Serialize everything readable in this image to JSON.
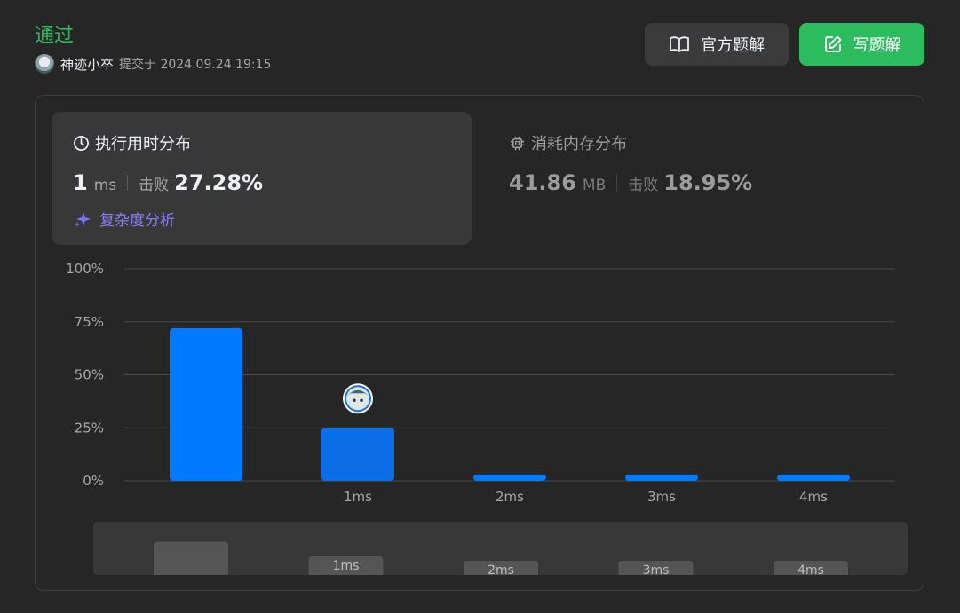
{
  "submission": {
    "status": "通过",
    "user_name": "神迹小卒",
    "submitted_label": "提交于 2024.09.24 19:15"
  },
  "buttons": {
    "editorial": "官方题解",
    "write_solution": "写题解"
  },
  "runtime": {
    "title": "执行用时分布",
    "value": "1",
    "unit": "ms",
    "beats_label": "击败",
    "beats_pct": "27.28%",
    "complexity_link": "复杂度分析"
  },
  "memory": {
    "title": "消耗内存分布",
    "value": "41.86",
    "unit": "MB",
    "beats_label": "击败",
    "beats_pct": "18.95%"
  },
  "colors": {
    "accepted": "#2cbb5d",
    "bar": "#007aff",
    "bar_selected": "#0a6fe6",
    "complexity_link": "#8b7df5"
  },
  "chart_data": {
    "type": "bar",
    "categories": [
      "",
      "1ms",
      "2ms",
      "3ms",
      "4ms"
    ],
    "values": [
      72,
      25,
      3,
      3,
      3
    ],
    "highlight_index": 1,
    "ylim": [
      0,
      100
    ],
    "yticks": [
      "100%",
      "75%",
      "50%",
      "25%",
      "0%"
    ],
    "ytick_values": [
      100,
      75,
      50,
      25,
      0
    ],
    "grid": true,
    "overview_labels": [
      "",
      "1ms",
      "2ms",
      "3ms",
      "4ms"
    ]
  }
}
